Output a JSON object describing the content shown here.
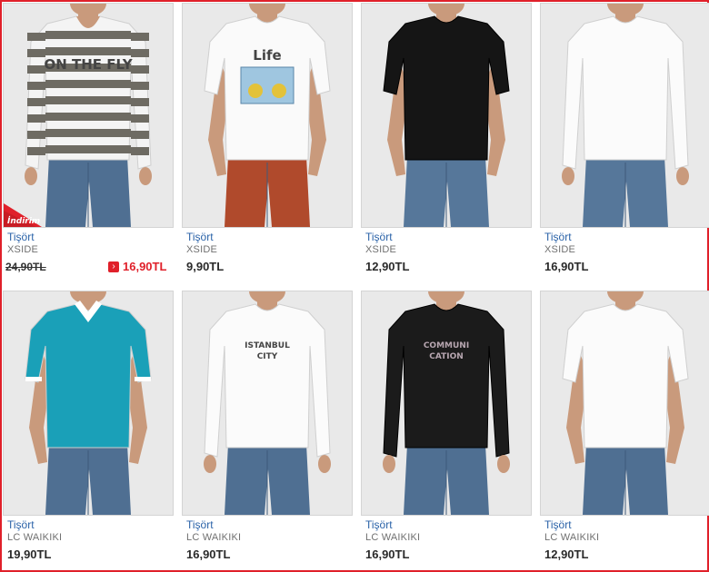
{
  "products": [
    {
      "category": "Tişört",
      "brand": "XSIDE",
      "old_price": "24,90TL",
      "price": "16,90TL",
      "badge": "İndirim",
      "shirt_color": "#f4f4f4",
      "stripe_color": "#6e6b63",
      "sleeve": "long",
      "pants_color": "#4f6f92",
      "print": "ON THE FLY"
    },
    {
      "category": "Tişört",
      "brand": "XSIDE",
      "price": "9,90TL",
      "shirt_color": "#fafafa",
      "sleeve": "short",
      "pants_color": "#b04a2c",
      "print": "Life"
    },
    {
      "category": "Tişört",
      "brand": "XSIDE",
      "price": "12,90TL",
      "shirt_color": "#151515",
      "sleeve": "short",
      "pants_color": "#56779a",
      "print": ""
    },
    {
      "category": "Tişört",
      "brand": "XSIDE",
      "price": "16,90TL",
      "shirt_color": "#fbfbfb",
      "sleeve": "long",
      "pants_color": "#56779a",
      "print": ""
    },
    {
      "category": "Tişört",
      "brand": "LC WAIKIKI",
      "price": "19,90TL",
      "shirt_color": "#1aa0b8",
      "sleeve": "short",
      "pants_color": "#4f6f92",
      "print": ""
    },
    {
      "category": "Tişört",
      "brand": "LC WAIKIKI",
      "price": "16,90TL",
      "shirt_color": "#fbfbfb",
      "sleeve": "long",
      "pants_color": "#4f6f92",
      "print": "ISTANBUL CITY"
    },
    {
      "category": "Tişört",
      "brand": "LC WAIKIKI",
      "price": "16,90TL",
      "shirt_color": "#1b1b1b",
      "sleeve": "long",
      "pants_color": "#4f6f92",
      "print": "COMMUNI CATION"
    },
    {
      "category": "Tişört",
      "brand": "LC WAIKIKI",
      "price": "12,90TL",
      "shirt_color": "#fbfbfb",
      "sleeve": "short",
      "pants_color": "#4f6f92",
      "print": ""
    }
  ],
  "colors": {
    "link": "#2a62a8",
    "sale": "#e0202a",
    "frame": "#e0202a",
    "photo_bg": "#e9e9e9"
  }
}
